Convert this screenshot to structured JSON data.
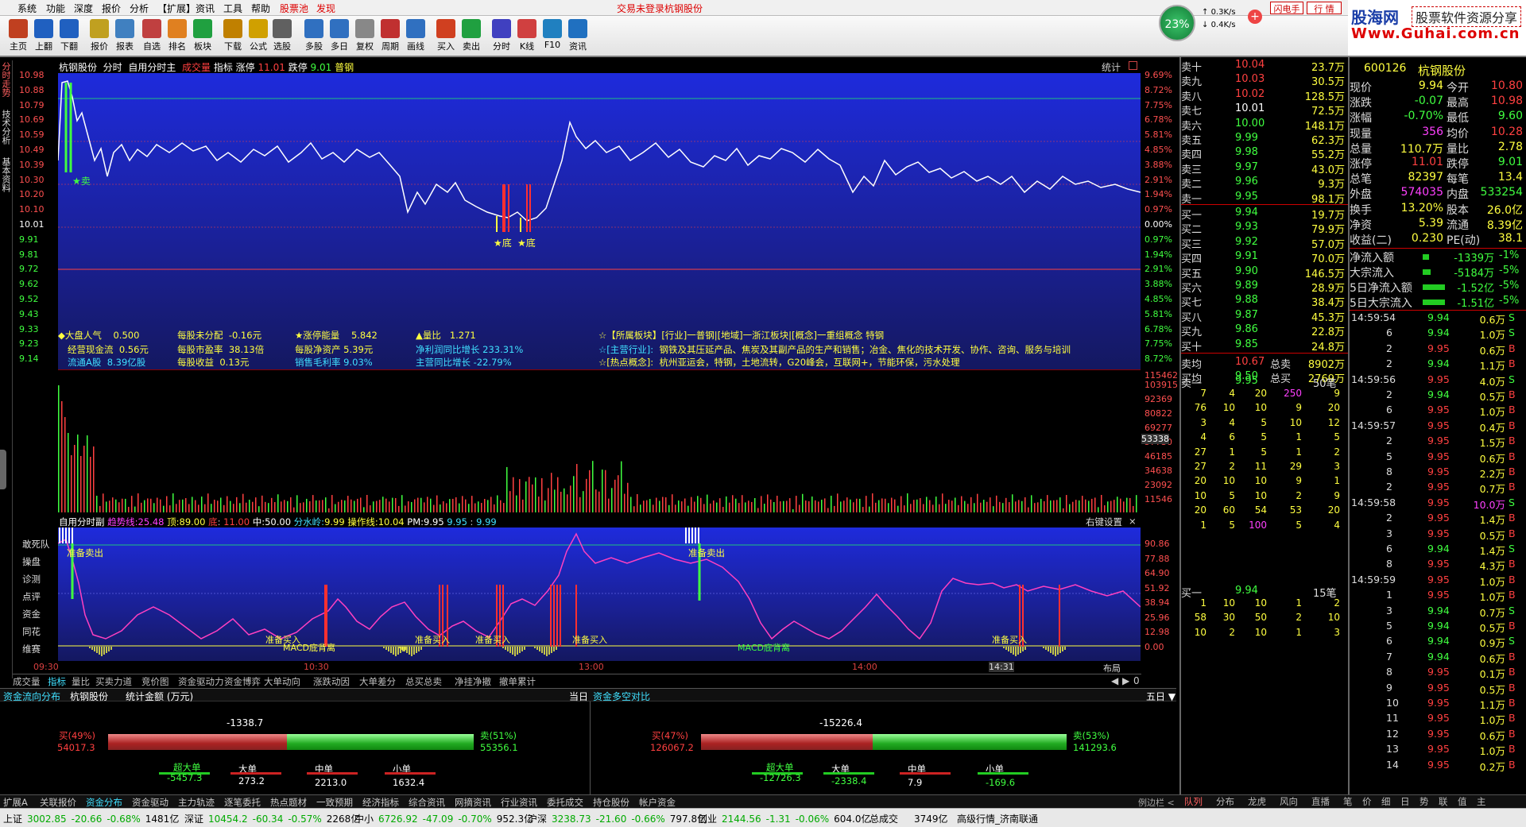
{
  "menu": {
    "items": [
      "系统",
      "功能",
      "深度",
      "报价",
      "分析",
      "【扩展】",
      "资讯",
      "工具",
      "帮助",
      "股票池",
      "发现"
    ],
    "status": "交易未登录",
    "status_stock": "杭钢股份",
    "net_percent": "23%",
    "up_speed": "0.3K/s",
    "down_speed": "0.4K/s",
    "flash_button": "闪电手",
    "quote_button": "行  情"
  },
  "logo": {
    "line1": "股海网",
    "line2": "股票软件资源分享",
    "line3": "Www.Guhai.com.cn"
  },
  "toolbar": [
    "主页",
    "上翻",
    "下翻",
    "报价",
    "报表",
    "自选",
    "排名",
    "板块",
    "下载",
    "公式",
    "选股",
    "多股",
    "多日",
    "复权",
    "周期",
    "画线",
    "买入",
    "卖出",
    "分时",
    "K线",
    "F10",
    "资讯"
  ],
  "left_tabs": [
    "分时走势",
    "技术分析",
    "基本资料"
  ],
  "chart_title": {
    "stock": "杭钢股份",
    "items": [
      "分时",
      "自用分时主"
    ],
    "deal": "成交量",
    "indicator": "指标",
    "limit_up_label": "涨停",
    "limit_up": "11.01",
    "limit_down_label": "跌停",
    "limit_down": "9.01",
    "industry": "普钢",
    "stat": "统计"
  },
  "price_axis": [
    "10.98",
    "10.88",
    "10.79",
    "10.69",
    "10.59",
    "10.49",
    "10.39",
    "10.30",
    "10.20",
    "10.10",
    "10.01",
    "9.91",
    "9.81",
    "9.72",
    "9.62",
    "9.52",
    "9.43",
    "9.33",
    "9.23",
    "9.14"
  ],
  "pct_axis": [
    "9.69%",
    "8.72%",
    "7.75%",
    "6.78%",
    "5.81%",
    "4.85%",
    "3.88%",
    "2.91%",
    "1.94%",
    "0.97%",
    "0.00%",
    "0.97%",
    "1.94%",
    "2.91%",
    "3.88%",
    "4.85%",
    "5.81%",
    "6.78%",
    "7.75%",
    "8.72%"
  ],
  "vol_axis": [
    "115462",
    "103915",
    "92369",
    "80822",
    "69277",
    "57730",
    "46185",
    "34638",
    "23092",
    "11546"
  ],
  "vol_axis_mid": "53338",
  "signals": {
    "sell": "卖",
    "bottom1": "底",
    "bottom2": "底"
  },
  "info_box": {
    "l1": [
      [
        "◆大盘人气",
        "0.500"
      ],
      [
        "每股未分配",
        "-0.16元"
      ],
      [
        "★涨停能量",
        "5.842"
      ],
      [
        "▲量比",
        "1.271"
      ]
    ],
    "l2": [
      [
        "经营现金流",
        "0.56元"
      ],
      [
        "每股市盈率",
        "38.13倍"
      ],
      [
        "每股净资产",
        "5.39元"
      ],
      [
        "净利润同比增长",
        "233.31%"
      ]
    ],
    "l3": [
      [
        "流通A股",
        "8.39亿股"
      ],
      [
        "每股收益",
        "0.13元"
      ],
      [
        "销售毛利率",
        "9.03%"
      ],
      [
        "主营同比增长",
        "-22.79%"
      ]
    ],
    "sector_title": "☆【所属板块】",
    "sector_value": "[行业]一普钢|[地域]一浙江板块|[概念]一重组概念 特钢",
    "main_biz_title": "☆[主营行业]:",
    "main_biz": "钢铁及其压延产品、焦炭及其副产品的生产和销售；冶金、焦化的技术开发、协作、咨询、服务与培训",
    "hot_title": "☆[热点概念]:",
    "hot": "杭州亚运会，特钢，土地流转，G20峰会，互联网+，节能环保，污水处理"
  },
  "sub_title": {
    "name": "自用分时副",
    "trend_label": "趋势线:",
    "trend": "25.48",
    "top_label": "顶:",
    "top": "89.00",
    "bottom_label": "底",
    "bottom": "11.00",
    "mid_label": "中:",
    "mid": "50.00",
    "water_label": "分水岭:",
    "water": "9.99",
    "op_label": "操作线:",
    "op": "10.04",
    "pm_label": "PM:",
    "pm": "9.95",
    "v1": "9.95",
    "v2": "9.99",
    "right": "右键设置"
  },
  "sub_axis": [
    "90.86",
    "77.88",
    "64.90",
    "51.92",
    "38.94",
    "25.96",
    "12.98",
    "0.00"
  ],
  "sub_left": [
    "敢死队",
    "操盘",
    "诊测",
    "点评",
    "资金",
    "同花",
    "维赛"
  ],
  "sub_labels": {
    "ready_sell1": "准备卖出",
    "ready_sell2": "准备卖出",
    "ready_buy": "准备买入",
    "macd_bottom": "MACD底背离",
    "sell": "卖",
    "buy": "买"
  },
  "time_axis": [
    "09:30",
    "10:30",
    "13:00",
    "14:00",
    "14:31"
  ],
  "time_axis_right": "布局",
  "bottom_tabs": [
    "成交量",
    "指标",
    "量比",
    "买卖力道",
    "竞价图",
    "资金驱动力",
    "资金博弈",
    "大单动向",
    "涨跌动因",
    "大单差分",
    "总买总卖",
    "净挂净撤",
    "撤单累计"
  ],
  "fund_panel": {
    "title": "资金流向分布",
    "stock": "杭钢股份",
    "unit": "统计金额 (万元)",
    "period_left": "当日",
    "left": {
      "net": "-1338.7",
      "buy_pct": "买(49%)",
      "buy": "54017.3",
      "sell_pct": "卖(51%)",
      "sell": "55356.1",
      "buy_frac": 0.49,
      "cats": [
        [
          "超大单",
          "-5457.3"
        ],
        [
          "大单",
          "273.2"
        ],
        [
          "中单",
          "2213.0"
        ],
        [
          "小单",
          "1632.4"
        ]
      ]
    },
    "right_title": "资金多空对比",
    "period_right": "五日",
    "right": {
      "net": "-15226.4",
      "buy_pct": "买(47%)",
      "buy": "126067.2",
      "sell_pct": "卖(53%)",
      "sell": "141293.6",
      "buy_frac": 0.47,
      "cats": [
        [
          "超大单",
          "-12726.3"
        ],
        [
          "大单",
          "-2338.4"
        ],
        [
          "中单",
          "7.9"
        ],
        [
          "小单",
          "-169.6"
        ]
      ]
    }
  },
  "order_book": {
    "sells": [
      [
        "卖十",
        "10.04",
        "23.7万"
      ],
      [
        "卖九",
        "10.03",
        "30.5万"
      ],
      [
        "卖八",
        "10.02",
        "128.5万"
      ],
      [
        "卖七",
        "10.01",
        "72.5万"
      ],
      [
        "卖六",
        "10.00",
        "148.1万"
      ],
      [
        "卖五",
        "9.99",
        "62.3万"
      ],
      [
        "卖四",
        "9.98",
        "55.2万"
      ],
      [
        "卖三",
        "9.97",
        "43.0万"
      ],
      [
        "卖二",
        "9.96",
        "9.3万"
      ],
      [
        "卖一",
        "9.95",
        "98.1万"
      ]
    ],
    "buys": [
      [
        "买一",
        "9.94",
        "19.7万"
      ],
      [
        "买二",
        "9.93",
        "79.9万"
      ],
      [
        "买三",
        "9.92",
        "57.0万"
      ],
      [
        "买四",
        "9.91",
        "70.0万"
      ],
      [
        "买五",
        "9.90",
        "146.5万"
      ],
      [
        "买六",
        "9.89",
        "28.9万"
      ],
      [
        "买七",
        "9.88",
        "38.4万"
      ],
      [
        "买八",
        "9.87",
        "45.3万"
      ],
      [
        "买九",
        "9.86",
        "22.8万"
      ],
      [
        "买十",
        "9.85",
        "24.8万"
      ]
    ],
    "avg_sell_label": "卖均",
    "avg_sell": "10.67",
    "total_sell_label": "总卖",
    "total_sell": "8902万",
    "avg_buy_label": "买均",
    "avg_buy": "9.50",
    "total_buy_label": "总买",
    "total_buy": "2769万",
    "sell1_label": "卖一",
    "sell1_price": "9.95",
    "sell1_count": "50笔",
    "queue": [
      [
        "7",
        "4",
        "20",
        "250",
        "9"
      ],
      [
        "76",
        "10",
        "10",
        "9",
        "20"
      ],
      [
        "3",
        "4",
        "5",
        "10",
        "12"
      ],
      [
        "4",
        "6",
        "5",
        "1",
        "5"
      ],
      [
        "27",
        "1",
        "5",
        "1",
        "2"
      ],
      [
        "27",
        "2",
        "11",
        "29",
        "3"
      ],
      [
        "20",
        "10",
        "10",
        "9",
        "1"
      ],
      [
        "10",
        "5",
        "10",
        "2",
        "9"
      ],
      [
        "20",
        "60",
        "54",
        "53",
        "20"
      ],
      [
        "1",
        "5",
        "100",
        "5",
        "4"
      ]
    ],
    "buy1_label": "买一",
    "buy1_price": "9.94",
    "buy1_count": "15笔",
    "buy_queue": [
      [
        "1",
        "10",
        "10",
        "1",
        "2"
      ],
      [
        "58",
        "30",
        "50",
        "2",
        "10"
      ],
      [
        "10",
        "2",
        "10",
        "1",
        "3"
      ]
    ]
  },
  "quote": {
    "code": "600126",
    "name": "杭钢股份",
    "rows": [
      [
        "现价",
        "9.94",
        "今开",
        "10.80"
      ],
      [
        "涨跌",
        "-0.07",
        "最高",
        "10.98"
      ],
      [
        "涨幅",
        "-0.70%",
        "最低",
        "9.60"
      ],
      [
        "现量",
        "356",
        "均价",
        "10.28"
      ],
      [
        "总量",
        "110.7万",
        "量比",
        "2.78"
      ],
      [
        "涨停",
        "11.01",
        "跌停",
        "9.01"
      ],
      [
        "总笔",
        "82397",
        "每笔",
        "13.4"
      ],
      [
        "外盘",
        "574035",
        "内盘",
        "533254"
      ],
      [
        "换手",
        "13.20%",
        "股本",
        "26.0亿"
      ],
      [
        "净资",
        "5.39",
        "流通",
        "8.39亿"
      ],
      [
        "收益(二)",
        "0.230",
        "PE(动)",
        "38.1"
      ]
    ],
    "flows": [
      [
        "净流入额",
        "-1339万",
        "-1%"
      ],
      [
        "大宗流入",
        "-5184万",
        "-5%"
      ],
      [
        "5日净流入额",
        "-1.52亿",
        "-5%"
      ],
      [
        "5日大宗流入",
        "-1.51亿",
        "-5%"
      ]
    ]
  },
  "ticks": [
    [
      "14:59:54",
      "9.94",
      "0.6万",
      "S"
    ],
    [
      "6",
      "9.94",
      "1.0万",
      "S"
    ],
    [
      "2",
      "9.95",
      "0.6万",
      "B"
    ],
    [
      "2",
      "9.94",
      "1.1万",
      "B"
    ],
    [
      "14:59:56",
      "9.95",
      "4.0万",
      "S"
    ],
    [
      "2",
      "9.94",
      "0.5万",
      "B"
    ],
    [
      "6",
      "9.95",
      "1.0万",
      "B"
    ],
    [
      "14:59:57",
      "9.95",
      "0.4万",
      "B"
    ],
    [
      "2",
      "9.95",
      "1.5万",
      "B"
    ],
    [
      "5",
      "9.95",
      "0.6万",
      "B"
    ],
    [
      "8",
      "9.95",
      "2.2万",
      "B"
    ],
    [
      "2",
      "9.95",
      "0.7万",
      "B"
    ],
    [
      "14:59:58",
      "9.95",
      "10.0万",
      "S"
    ],
    [
      "2",
      "9.95",
      "1.4万",
      "B"
    ],
    [
      "3",
      "9.95",
      "0.5万",
      "B"
    ],
    [
      "6",
      "9.94",
      "1.4万",
      "S"
    ],
    [
      "8",
      "9.95",
      "4.3万",
      "B"
    ],
    [
      "14:59:59",
      "9.95",
      "1.0万",
      "B"
    ],
    [
      "1",
      "9.95",
      "1.0万",
      "B"
    ],
    [
      "3",
      "9.94",
      "0.7万",
      "S"
    ],
    [
      "5",
      "9.94",
      "0.5万",
      "B"
    ],
    [
      "6",
      "9.94",
      "0.9万",
      "S"
    ],
    [
      "7",
      "9.94",
      "0.6万",
      "B"
    ],
    [
      "8",
      "9.95",
      "0.1万",
      "B"
    ],
    [
      "9",
      "9.95",
      "0.5万",
      "B"
    ],
    [
      "10",
      "9.95",
      "1.1万",
      "B"
    ],
    [
      "11",
      "9.95",
      "1.0万",
      "B"
    ],
    [
      "12",
      "9.95",
      "0.6万",
      "B"
    ],
    [
      "13",
      "9.95",
      "1.0万",
      "B"
    ],
    [
      "14",
      "9.95",
      "0.2万",
      "B"
    ]
  ],
  "bottom_nav": [
    "扩展A",
    "关联报价",
    "资金分布",
    "资金驱动",
    "主力轨迹",
    "逐笔委托",
    "热点题材",
    "一致预期",
    "经济指标",
    "综合资讯",
    "网摘资讯",
    "行业资讯",
    "委托成交",
    "持仓股份",
    "帐户资金"
  ],
  "status_bar": {
    "sh": [
      "上证",
      "3002.85",
      "-20.66",
      "-0.68%",
      "1481亿"
    ],
    "sz": [
      "深证",
      "10454.2",
      "-60.34",
      "-0.57%",
      "2268亿"
    ],
    "zx": [
      "中小",
      "6726.92",
      "-47.09",
      "-0.70%",
      "952.3亿"
    ],
    "hs": [
      "沪深",
      "3238.73",
      "-21.60",
      "-0.66%",
      "797.8亿"
    ],
    "cy": [
      "创业",
      "2144.56",
      "-1.31",
      "-0.06%",
      "604.0亿"
    ],
    "total_label": "总成交",
    "total": "3749亿",
    "server": "高级行情_济南联通",
    "right_tabs": [
      "队列",
      "分布",
      "龙虎",
      "风向",
      "直播",
      "笔",
      "价",
      "细",
      "日",
      "势",
      "联",
      "值",
      "主"
    ]
  }
}
